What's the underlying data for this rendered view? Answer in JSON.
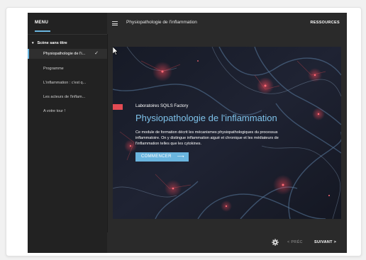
{
  "sidebar": {
    "menu_title": "MENU",
    "scene_title": "Scène sans titre",
    "items": [
      {
        "label": "Physiopathologie de l'i..."
      },
      {
        "label": "Programme"
      },
      {
        "label": "L'inflammation : c'est q..."
      },
      {
        "label": "Les acteurs de l'inflam..."
      },
      {
        "label": "A votre tour !"
      }
    ]
  },
  "header": {
    "course_title": "Physiopathologie de l'inflammation",
    "resources_label": "RESSOURCES"
  },
  "slide": {
    "company": "Laboratoires SQILS Factory",
    "title": "Physiopathologie de l'inflammation",
    "description": "Ce module de formation décrit les mécanismes physiopathologiques du processus inflammatoire. On y distingue inflammation aiguë et chronique et les médiateurs de l'inflammation telles que les cytokines.",
    "start_label": "COMMENCER",
    "start_arrow": "⟶"
  },
  "footer": {
    "prev_label": "< PRÉC",
    "next_label": "SUIVANT >"
  },
  "colors": {
    "accent": "#6ab5df",
    "red_tag": "#e34b53",
    "background": "#2a2a2a"
  }
}
